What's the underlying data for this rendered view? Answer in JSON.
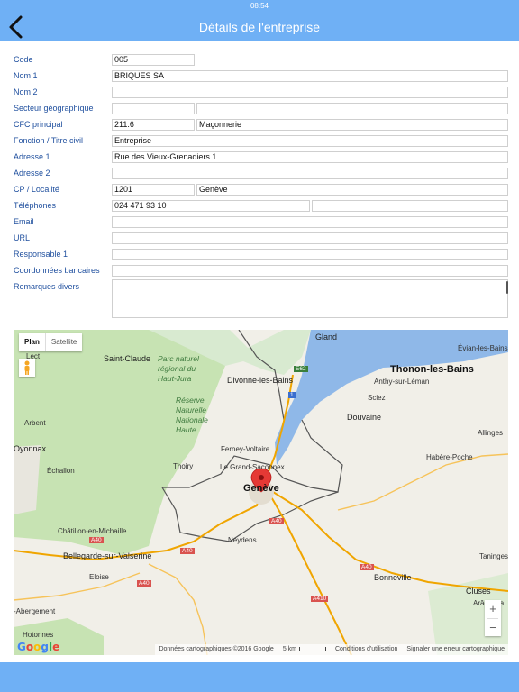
{
  "status": {
    "time": "08:54"
  },
  "nav": {
    "title": "Détails de l'entreprise"
  },
  "form": {
    "code": {
      "label": "Code",
      "value": "005"
    },
    "nom1": {
      "label": "Nom 1",
      "value": "BRIQUES SA"
    },
    "nom2": {
      "label": "Nom 2",
      "value": ""
    },
    "secteur": {
      "label": "Secteur géographique",
      "value1": "",
      "value2": ""
    },
    "cfc": {
      "label": "CFC principal",
      "value1": "211.6",
      "value2": "Maçonnerie"
    },
    "fonction": {
      "label": "Fonction / Titre civil",
      "value": "Entreprise"
    },
    "adresse1": {
      "label": "Adresse 1",
      "value": "Rue des Vieux-Grenadiers 1"
    },
    "adresse2": {
      "label": "Adresse 2",
      "value": ""
    },
    "cp": {
      "label": "CP / Localité",
      "value1": "1201",
      "value2": "Genève"
    },
    "telephones": {
      "label": "Téléphones",
      "value1": "024 471 93 10",
      "value2": "",
      "value3": ""
    },
    "email": {
      "label": "Email",
      "value": ""
    },
    "url": {
      "label": "URL",
      "value": ""
    },
    "responsable": {
      "label": "Responsable 1",
      "value": ""
    },
    "banque": {
      "label": "Coordonnées bancaires",
      "value": ""
    },
    "remarques": {
      "label": "Remarques divers",
      "value": ""
    }
  },
  "map": {
    "type_plan": "Plan",
    "type_sat": "Satellite",
    "zoom_in": "+",
    "zoom_out": "−",
    "google": [
      "G",
      "o",
      "o",
      "g",
      "l",
      "e"
    ],
    "attribution": "Données cartographiques ©2016 Google",
    "scale": "5 km",
    "terms": "Conditions d'utilisation",
    "report": "Signaler une erreur cartographique",
    "labels": {
      "gland": "Gland",
      "evian": "Évian-les-Bains",
      "lect": "Lect",
      "saintclaude": "Saint-Claude",
      "parc1": "Parc naturel",
      "parc2": "régional du",
      "parc3": "Haut-Jura",
      "divonne": "Divonne-les-Bains",
      "thonon": "Thonon-les-Bains",
      "anthy": "Anthy-sur-Léman",
      "sciez": "Sciez",
      "reserve1": "Réserve",
      "reserve2": "Naturelle",
      "reserve3": "Nationale",
      "reserve4": "Haute...",
      "douvaine": "Douvaine",
      "arbent": "Arbent",
      "allinges": "Allinges",
      "oyonnax": "Oyonnax",
      "ferney": "Ferney-Voltaire",
      "habere": "Habère-Poche",
      "echallon": "Échallon",
      "thoiry": "Thoiry",
      "grandsac": "Le Grand-Saconnex",
      "geneve": "Genève",
      "chatillon": "Châtillon-en-Michaille",
      "bellegarde": "Bellegarde-sur-Valserine",
      "neydens": "Neydens",
      "taninges": "Taninges",
      "eloise": "Eloise",
      "bonneville": "Bonneville",
      "cluses": "Cluses",
      "arache": "Arâche-la",
      "abergement": "-Abergement",
      "hotonnes": "Hotonnes",
      "e62": "E62",
      "a40a": "A40",
      "a40b": "A40",
      "a40c": "A40",
      "a40d": "A40",
      "a40e": "A40",
      "a41": "A41",
      "a410": "A410",
      "r1": "1"
    }
  },
  "colors": {
    "accent": "#6fb0f5",
    "label": "#1f4f9e",
    "lake": "#8fb8e8",
    "forest": "#c7e3b3",
    "marker": "#e53935"
  }
}
